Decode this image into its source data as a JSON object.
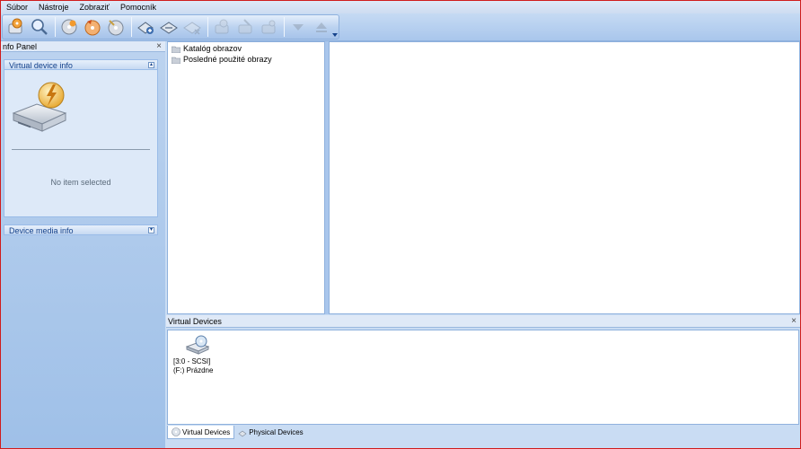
{
  "menu": [
    "Súbor",
    "Nástroje",
    "Zobraziť",
    "Pomocník"
  ],
  "toolbar": {
    "buttons": [
      {
        "icon": "mount-image-icon",
        "enabled": true
      },
      {
        "icon": "search-image-icon",
        "enabled": true
      },
      {
        "sep": true
      },
      {
        "icon": "disc-add-icon",
        "enabled": true
      },
      {
        "icon": "disc-convert-icon",
        "enabled": true
      },
      {
        "icon": "disc-tools-icon",
        "enabled": true
      },
      {
        "sep": true
      },
      {
        "icon": "add-drive-icon",
        "enabled": true
      },
      {
        "icon": "drive-icon",
        "enabled": true
      },
      {
        "icon": "remove-drive-icon",
        "enabled": false
      },
      {
        "sep": true
      },
      {
        "icon": "mount-icon",
        "enabled": false
      },
      {
        "icon": "unmount-icon",
        "enabled": false
      },
      {
        "icon": "unmount-all-icon",
        "enabled": false
      },
      {
        "sep": true
      },
      {
        "icon": "move-down-icon",
        "enabled": false
      },
      {
        "icon": "eject-icon",
        "enabled": false
      }
    ]
  },
  "info_panel": {
    "title": "nfo Panel",
    "virtual_device_info": {
      "title": "Virtual device info",
      "empty_text": "No item selected"
    },
    "device_media_info": {
      "title": "Device media info"
    }
  },
  "tree": {
    "items": [
      {
        "label": "Katalóg obrazov"
      },
      {
        "label": "Posledné použité obrazy"
      }
    ]
  },
  "virtual_devices": {
    "title": "Virtual Devices",
    "devices": [
      {
        "line1": "[3:0 - SCSI]",
        "line2": "(F:) Prázdne"
      }
    ],
    "tabs": [
      {
        "label": "Virtual Devices",
        "active": true
      },
      {
        "label": "Physical Devices",
        "active": false
      }
    ]
  },
  "colors": {
    "accent": "#15428b",
    "border": "#d01c1c"
  }
}
